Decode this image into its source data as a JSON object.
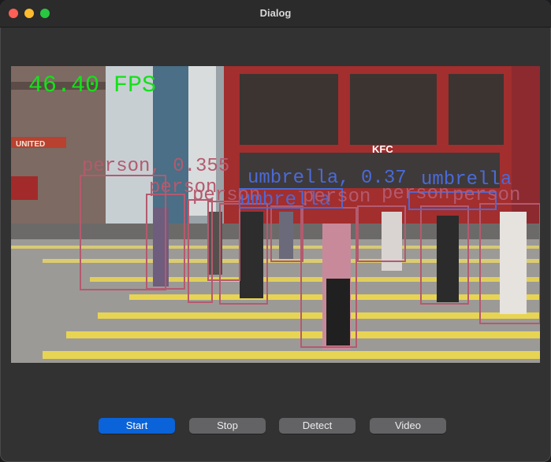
{
  "window": {
    "title": "Dialog"
  },
  "video": {
    "fps_text": "46.40 FPS",
    "detections": [
      {
        "label": "person, 0.355",
        "color": "#b45a6e"
      },
      {
        "label": "umbrella, 0.37",
        "color": "#4a6ad8"
      },
      {
        "label": "person",
        "color": "#b45a6e"
      },
      {
        "label": "umbrella",
        "color": "#4a6ad8"
      }
    ],
    "signs": {
      "kfc": "KFC",
      "united": "UNITED"
    }
  },
  "buttons": {
    "start": "Start",
    "stop": "Stop",
    "detect": "Detect",
    "video": "Video"
  }
}
